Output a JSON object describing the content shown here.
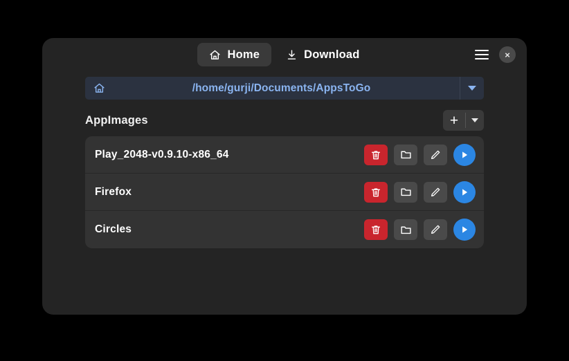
{
  "window": {
    "tabs": [
      {
        "label": "Home",
        "icon": "home-icon",
        "active": true
      },
      {
        "label": "Download",
        "icon": "download-icon",
        "active": false
      }
    ],
    "controls": {
      "menu_icon": "hamburger-menu-icon",
      "close_label": "×",
      "close_icon": "close-icon"
    }
  },
  "pathbar": {
    "home_icon": "home-icon",
    "path": "/home/gurji/Documents/AppsToGo",
    "dropdown_icon": "chevron-down-icon"
  },
  "section": {
    "title": "AppImages",
    "add_label": "+",
    "add_icon": "plus-icon",
    "dropdown_icon": "chevron-down-icon"
  },
  "apps": [
    {
      "name": "Play_2048-v0.9.10-x86_64",
      "actions": [
        {
          "name": "delete",
          "icon": "trash-icon"
        },
        {
          "name": "open-folder",
          "icon": "folder-icon"
        },
        {
          "name": "edit",
          "icon": "pencil-icon"
        },
        {
          "name": "run",
          "icon": "play-icon"
        }
      ]
    },
    {
      "name": "Firefox",
      "actions": [
        {
          "name": "delete",
          "icon": "trash-icon"
        },
        {
          "name": "open-folder",
          "icon": "folder-icon"
        },
        {
          "name": "edit",
          "icon": "pencil-icon"
        },
        {
          "name": "run",
          "icon": "play-icon"
        }
      ]
    },
    {
      "name": "Circles",
      "actions": [
        {
          "name": "delete",
          "icon": "trash-icon"
        },
        {
          "name": "open-folder",
          "icon": "folder-icon"
        },
        {
          "name": "edit",
          "icon": "pencil-icon"
        },
        {
          "name": "run",
          "icon": "play-icon"
        }
      ]
    }
  ],
  "colors": {
    "background": "#000000",
    "window": "#242424",
    "list": "#333333",
    "accent_blue": "#2b86e3",
    "path_text": "#8ab4f0",
    "danger_red": "#c9252d",
    "button_gray": "#4a4a4a"
  }
}
